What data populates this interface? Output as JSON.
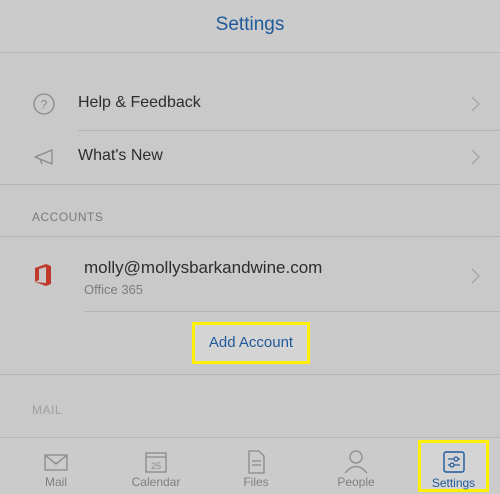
{
  "header": {
    "title": "Settings"
  },
  "menu": {
    "help_label": "Help & Feedback",
    "help_icon": "question-circle-icon",
    "whatsnew_label": "What's New",
    "whatsnew_icon": "megaphone-icon"
  },
  "accounts": {
    "section_label": "ACCOUNTS",
    "items": [
      {
        "email": "molly@mollysbarkandwine.com",
        "type": "Office 365",
        "icon": "office365-icon"
      }
    ],
    "add_label": "Add Account"
  },
  "mail_section": {
    "label": "MAIL"
  },
  "tabs": [
    {
      "label": "Mail",
      "icon": "mail-icon"
    },
    {
      "label": "Calendar",
      "icon": "calendar-icon",
      "badge": "25"
    },
    {
      "label": "Files",
      "icon": "files-icon"
    },
    {
      "label": "People",
      "icon": "person-icon"
    },
    {
      "label": "Settings",
      "icon": "settings-sliders-icon",
      "active": true
    }
  ],
  "colors": {
    "accent": "#1f5a9a",
    "highlight": "#ffef00",
    "office": "#c0392b"
  }
}
